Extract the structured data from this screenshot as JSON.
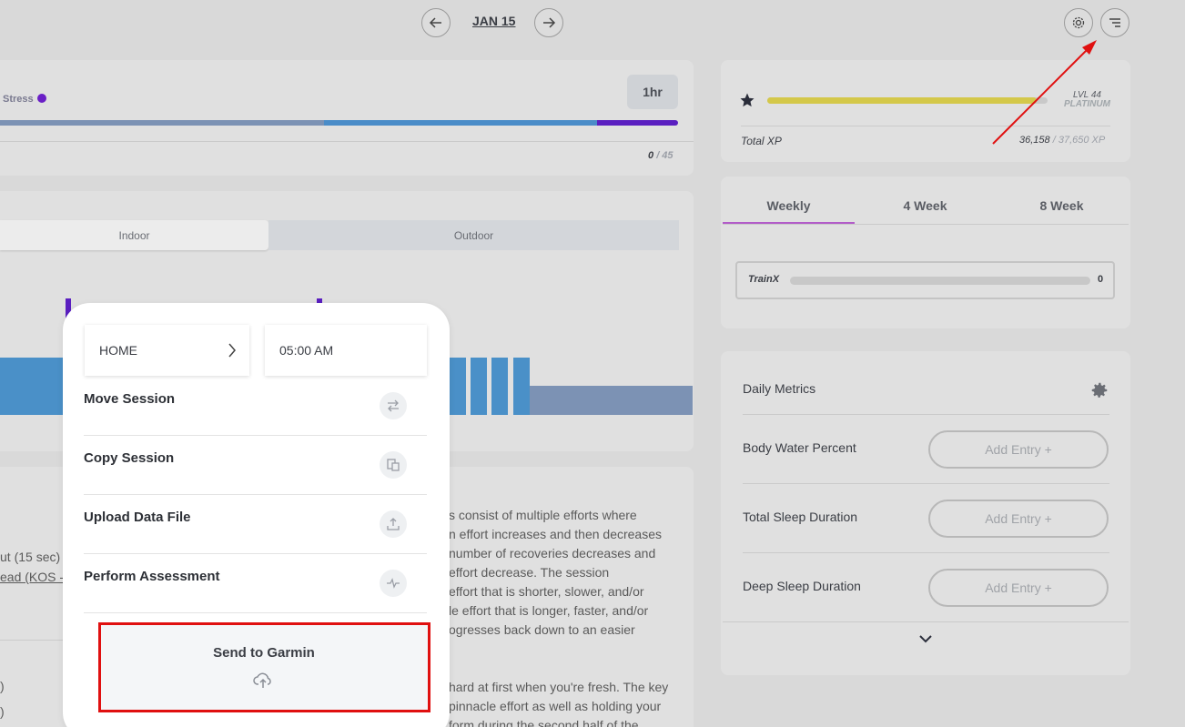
{
  "header": {
    "date": "JAN 15"
  },
  "session": {
    "stress_label": "Stress",
    "duration": "1hr",
    "score": "0",
    "score_total": "/ 45",
    "env": {
      "indoor": "Indoor",
      "outdoor": "Outdoor"
    }
  },
  "xp": {
    "level": "LVL 44",
    "tier": "PLATINUM",
    "total_label": "Total XP",
    "current": "36,158",
    "max": "/ 37,650 XP",
    "progress_fraction": 0.96
  },
  "tabs": [
    "Weekly",
    "4 Week",
    "8 Week"
  ],
  "trainx": {
    "label": "TrainX",
    "value": "0"
  },
  "metrics": {
    "title": "Daily Metrics",
    "add_label": "Add Entry +",
    "items": [
      "Body Water Percent",
      "Total Sleep Duration",
      "Deep Sleep Duration"
    ]
  },
  "description_lines": [
    "s consist of multiple efforts where",
    "n effort increases and then decreases",
    "number of recoveries decreases and",
    "effort decrease. The session",
    "effort that is shorter, slower, and/or",
    "le effort that is longer, faster, and/or",
    "ogresses back down to an easier",
    "",
    "hard at first when you're fresh. The key",
    "pinnacle effort as well as holding your",
    "form during the second half of the"
  ],
  "left_snippets": [
    "ut (15 sec)",
    "ead (KOS -"
  ],
  "popup": {
    "location": "HOME",
    "time": "05:00 AM",
    "items": [
      "Move Session",
      "Copy Session",
      "Upload Data File",
      "Perform Assessment"
    ],
    "garmin": "Send to Garmin"
  },
  "colors": {
    "zone1": "#7c92b4",
    "zone2": "#4a8cc8",
    "zone3": "#5a1fc0",
    "chart_bar": "#4a90c8",
    "chart_bar_muted": "#7c92b4",
    "accent_purple": "#6a1fc6"
  }
}
